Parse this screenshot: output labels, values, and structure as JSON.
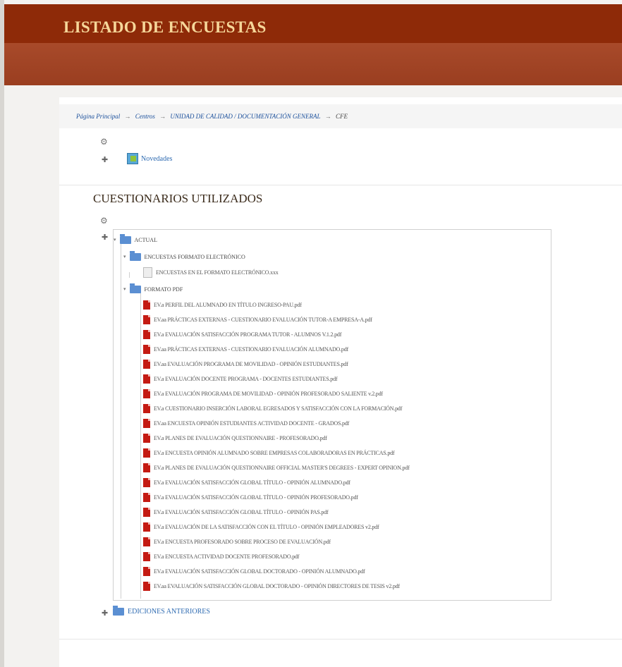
{
  "header": {
    "title": "LISTADO DE ENCUESTAS"
  },
  "breadcrumb": {
    "items": [
      "Página Principal",
      "Centros",
      "UNIDAD DE CALIDAD / DOCUMENTACIÓN GENERAL",
      "CFE"
    ],
    "separator": "→"
  },
  "top_block": {
    "gear_icon": "gear-icon",
    "news_label": "Novedades"
  },
  "section": {
    "title": "CUESTIONARIOS UTILIZADOS"
  },
  "tree": {
    "root_label": "ACTUAL",
    "groups": [
      {
        "label": "ENCUESTAS FORMATO ELECTRÓNICO",
        "items": [
          "ENCUESTAS EN EL FORMATO ELECTRÓNICO.xxx"
        ]
      },
      {
        "label": "FORMATO PDF",
        "items": [
          "EV.a PERFIL DEL ALUMNADO EN TÍTULO INGRESO-PAU.pdf",
          "EV.aa PRÁCTICAS EXTERNAS - CUESTIONARIO EVALUACIÓN TUTOR-A EMPRESA-A.pdf",
          "EV.a EVALUACIÓN SATISFACCIÓN PROGRAMA TUTOR - ALUMNOS V.1.2.pdf",
          "EV.aa PRÁCTICAS EXTERNAS - CUESTIONARIO EVALUACIÓN ALUMNADO.pdf",
          "EV.aa EVALUACIÓN PROGRAMA DE MOVILIDAD - OPINIÓN ESTUDIANTES.pdf",
          "EV.a EVALUACIÓN DOCENTE PROGRAMA - DOCENTES ESTUDIANTES.pdf",
          "EV.a EVALUACIÓN PROGRAMA DE MOVILIDAD - OPINIÓN PROFESORADO SALIENTE v.2.pdf",
          "EV.a CUESTIONARIO INSERCIÓN LABORAL EGRESADOS Y SATISFACCIÓN CON LA FORMACIÓN.pdf",
          "EV.aa ENCUESTA OPINIÓN ESTUDIANTES ACTIVIDAD DOCENTE - GRADOS.pdf",
          "EV.a PLANES DE EVALUACIÓN QUESTIONNAIRE - PROFESORADO.pdf",
          "EV.a ENCUESTA OPINIÓN ALUMNADO SOBRE EMPRESAS COLABORADORAS EN PRÁCTICAS.pdf",
          "EV.a PLANES DE EVALUACIÓN QUESTIONNAIRE OFFICIAL MASTER'S DEGREES - EXPERT OPINION.pdf",
          "EV.a EVALUACIÓN SATISFACCIÓN GLOBAL TÍTULO - OPINIÓN ALUMNADO.pdf",
          "EV.a EVALUACIÓN SATISFACCIÓN GLOBAL TÍTULO - OPINIÓN PROFESORADO.pdf",
          "EV.a EVALUACIÓN SATISFACCIÓN GLOBAL TÍTULO - OPINIÓN PAS.pdf",
          "EV.a EVALUACIÓN DE LA SATISFACCIÓN CON EL TÍTULO - OPINIÓN EMPLEADORES v2.pdf",
          "EV.a ENCUESTA PROFESORADO SOBRE PROCESO DE EVALUACIÓN.pdf",
          "EV.a ENCUESTA ACTIVIDAD DOCENTE PROFESORADO.pdf",
          "EV.a EVALUACIÓN SATISFACCIÓN GLOBAL DOCTORADO - OPINIÓN ALUMNADO.pdf",
          "EV.aa EVALUACIÓN SATISFACCIÓN GLOBAL DOCTORADO - OPINIÓN DIRECTORES DE TESIS v2.pdf"
        ]
      }
    ]
  },
  "bottom": {
    "folder_label": "EDICIONES ANTERIORES"
  },
  "colors": {
    "header_bg": "#8e2a08",
    "header_text": "#f6d79a",
    "subbar": "#a04426",
    "link": "#2e6bb2",
    "pdf": "#c41a12",
    "folder": "#5b8fd2"
  }
}
